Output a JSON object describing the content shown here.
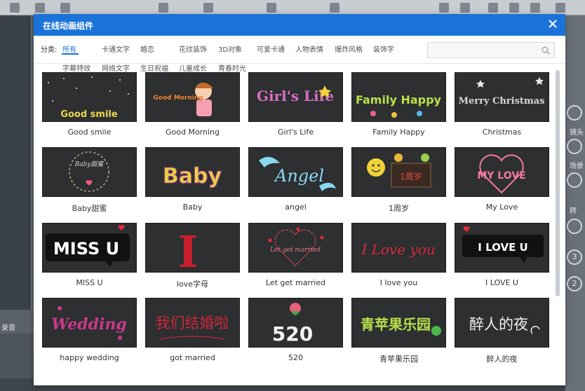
{
  "dialog": {
    "title": "在线动画组件",
    "close_icon": "close-icon"
  },
  "filter": {
    "label": "分类:",
    "categories": [
      "所有",
      "卡通文字",
      "婚恋",
      "花纹装饰",
      "3D对象",
      "可爱卡通",
      "人物表情",
      "爆炸风格",
      "装饰字",
      "字幕特效",
      "网络文字",
      "生日祝福",
      "儿童成长",
      "青春时光"
    ],
    "active": "所有"
  },
  "search": {
    "placeholder": "",
    "icon": "search-icon"
  },
  "items": [
    {
      "caption": "Good smile",
      "art": "Good smile"
    },
    {
      "caption": "Good Morning",
      "art": "Good Morning"
    },
    {
      "caption": "Girl's Life",
      "art": "Girl's Life"
    },
    {
      "caption": "Family Happy",
      "art": "Family Happy"
    },
    {
      "caption": "Christmas",
      "art": "Merry Christmas"
    },
    {
      "caption": "Baby甜蜜",
      "art": "Baby甜蜜"
    },
    {
      "caption": "Baby",
      "art": "Baby"
    },
    {
      "caption": "angel",
      "art": "Angel"
    },
    {
      "caption": "1周岁",
      "art": "1周岁"
    },
    {
      "caption": "My Love",
      "art": "MY LOVE"
    },
    {
      "caption": "MISS U",
      "art": "MISS U"
    },
    {
      "caption": "love字母",
      "art": "I"
    },
    {
      "caption": "Let get married",
      "art": "Let get married"
    },
    {
      "caption": "I love you",
      "art": "I Love you"
    },
    {
      "caption": "I LOVE U",
      "art": "I LOVE U"
    },
    {
      "caption": "happy wedding",
      "art": "Wedding"
    },
    {
      "caption": "got married",
      "art": "我们结婚啦"
    },
    {
      "caption": "520",
      "art": "520"
    },
    {
      "caption": "青苹果乐园",
      "art": "青苹果乐园"
    },
    {
      "caption": "醉人的夜",
      "art": "醉人的夜"
    }
  ],
  "background": {
    "left_label": "录音",
    "side_labels": [
      "镜头",
      "场景",
      "转"
    ],
    "side_buttons": [
      "3",
      "2"
    ]
  },
  "colors": {
    "header": "#1a73d9",
    "active_tab": "#1a73d9",
    "thumb_bg": "#2d2f31"
  }
}
